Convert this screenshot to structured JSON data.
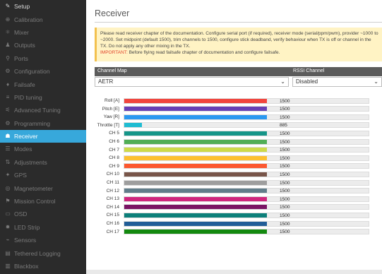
{
  "sidebar": {
    "items": [
      {
        "label": "Setup",
        "icon": "wrench-icon",
        "glyph": "✎",
        "state": "normal"
      },
      {
        "label": "Calibration",
        "icon": "crosshair-icon",
        "glyph": "⊕",
        "state": "dim"
      },
      {
        "label": "Mixer",
        "icon": "mixer-icon",
        "glyph": "⚛",
        "state": "dim"
      },
      {
        "label": "Outputs",
        "icon": "outputs-icon",
        "glyph": "♟",
        "state": "dim"
      },
      {
        "label": "Ports",
        "icon": "ports-icon",
        "glyph": "⚲",
        "state": "dim"
      },
      {
        "label": "Configuration",
        "icon": "gear-icon",
        "glyph": "⚙",
        "state": "dim"
      },
      {
        "label": "Failsafe",
        "icon": "failsafe-icon",
        "glyph": "♦",
        "state": "dim"
      },
      {
        "label": "PID tuning",
        "icon": "pid-icon",
        "glyph": "≡",
        "state": "dim"
      },
      {
        "label": "Advanced Tuning",
        "icon": "advanced-tuning-icon",
        "glyph": "⚟",
        "state": "dim"
      },
      {
        "label": "Programming",
        "icon": "programming-icon",
        "glyph": "⚙",
        "state": "dim"
      },
      {
        "label": "Receiver",
        "icon": "receiver-icon",
        "glyph": "☗",
        "state": "active"
      },
      {
        "label": "Modes",
        "icon": "modes-icon",
        "glyph": "☰",
        "state": "dim"
      },
      {
        "label": "Adjustments",
        "icon": "adjustments-icon",
        "glyph": "⇅",
        "state": "dim"
      },
      {
        "label": "GPS",
        "icon": "gps-icon",
        "glyph": "✦",
        "state": "dim"
      },
      {
        "label": "Magnetometer",
        "icon": "magnetometer-icon",
        "glyph": "◎",
        "state": "dim"
      },
      {
        "label": "Mission Control",
        "icon": "mission-control-icon",
        "glyph": "⚑",
        "state": "dim"
      },
      {
        "label": "OSD",
        "icon": "osd-icon",
        "glyph": "▭",
        "state": "dim"
      },
      {
        "label": "LED Strip",
        "icon": "led-strip-icon",
        "glyph": "✹",
        "state": "dim"
      },
      {
        "label": "Sensors",
        "icon": "sensors-icon",
        "glyph": "⌁",
        "state": "dim"
      },
      {
        "label": "Tethered Logging",
        "icon": "tethered-logging-icon",
        "glyph": "▤",
        "state": "dim"
      },
      {
        "label": "Blackbox",
        "icon": "blackbox-icon",
        "glyph": "▥",
        "state": "dim"
      }
    ]
  },
  "main": {
    "title": "Receiver",
    "notice": {
      "text": "Please read receiver chapter of the documentation. Configure serial port (if required), receiver mode (serial/ppm/pwm), provider ~1000 to ~2000. Set midpoint (default 1500), trim channels to 1500, configure stick deadband, verify behaviour when TX is off or channel in the TX. Do not apply any other mixing in the TX.",
      "important_label": "IMPORTANT:",
      "important_text": " Before flying read failsafe chapter of documentation and configure failsafe."
    },
    "channel_map": {
      "label": "Channel Map",
      "value": "AETR"
    },
    "rssi_channel": {
      "label": "RSSI Channel",
      "value": "Disabled"
    }
  },
  "channels": {
    "range": [
      1000,
      2000
    ],
    "items": [
      {
        "label": "Roll [A]",
        "value": "1500",
        "level": 1500,
        "color": "#f1453d"
      },
      {
        "label": "Pitch [E]",
        "value": "1500",
        "level": 1500,
        "color": "#673fb4"
      },
      {
        "label": "Yaw [R]",
        "value": "1500",
        "level": 1500,
        "color": "#2b98f0"
      },
      {
        "label": "Throttle [T]",
        "value": "885",
        "level": 885,
        "color": "#1fbcd2"
      },
      {
        "label": "CH 5",
        "value": "1500",
        "level": 1500,
        "color": "#159588"
      },
      {
        "label": "CH 6",
        "value": "1500",
        "level": 1500,
        "color": "#50ae55"
      },
      {
        "label": "CH 7",
        "value": "1500",
        "level": 1500,
        "color": "#cdda49"
      },
      {
        "label": "CH 8",
        "value": "1500",
        "level": 1500,
        "color": "#fdc02f"
      },
      {
        "label": "CH 9",
        "value": "1500",
        "level": 1500,
        "color": "#fc5830"
      },
      {
        "label": "CH 10",
        "value": "1500",
        "level": 1500,
        "color": "#785549"
      },
      {
        "label": "CH 11",
        "value": "1500",
        "level": 1500,
        "color": "#9e9e9e"
      },
      {
        "label": "CH 12",
        "value": "1500",
        "level": 1500,
        "color": "#617d8a"
      },
      {
        "label": "CH 13",
        "value": "1500",
        "level": 1500,
        "color": "#cf267d"
      },
      {
        "label": "CH 14",
        "value": "1500",
        "level": 1500,
        "color": "#7a1464"
      },
      {
        "label": "CH 15",
        "value": "1500",
        "level": 1500,
        "color": "#0c7f7a"
      },
      {
        "label": "CH 16",
        "value": "1500",
        "level": 1500,
        "color": "#215d97"
      },
      {
        "label": "CH 17",
        "value": "1500",
        "level": 1500,
        "color": "#13890f"
      }
    ]
  }
}
